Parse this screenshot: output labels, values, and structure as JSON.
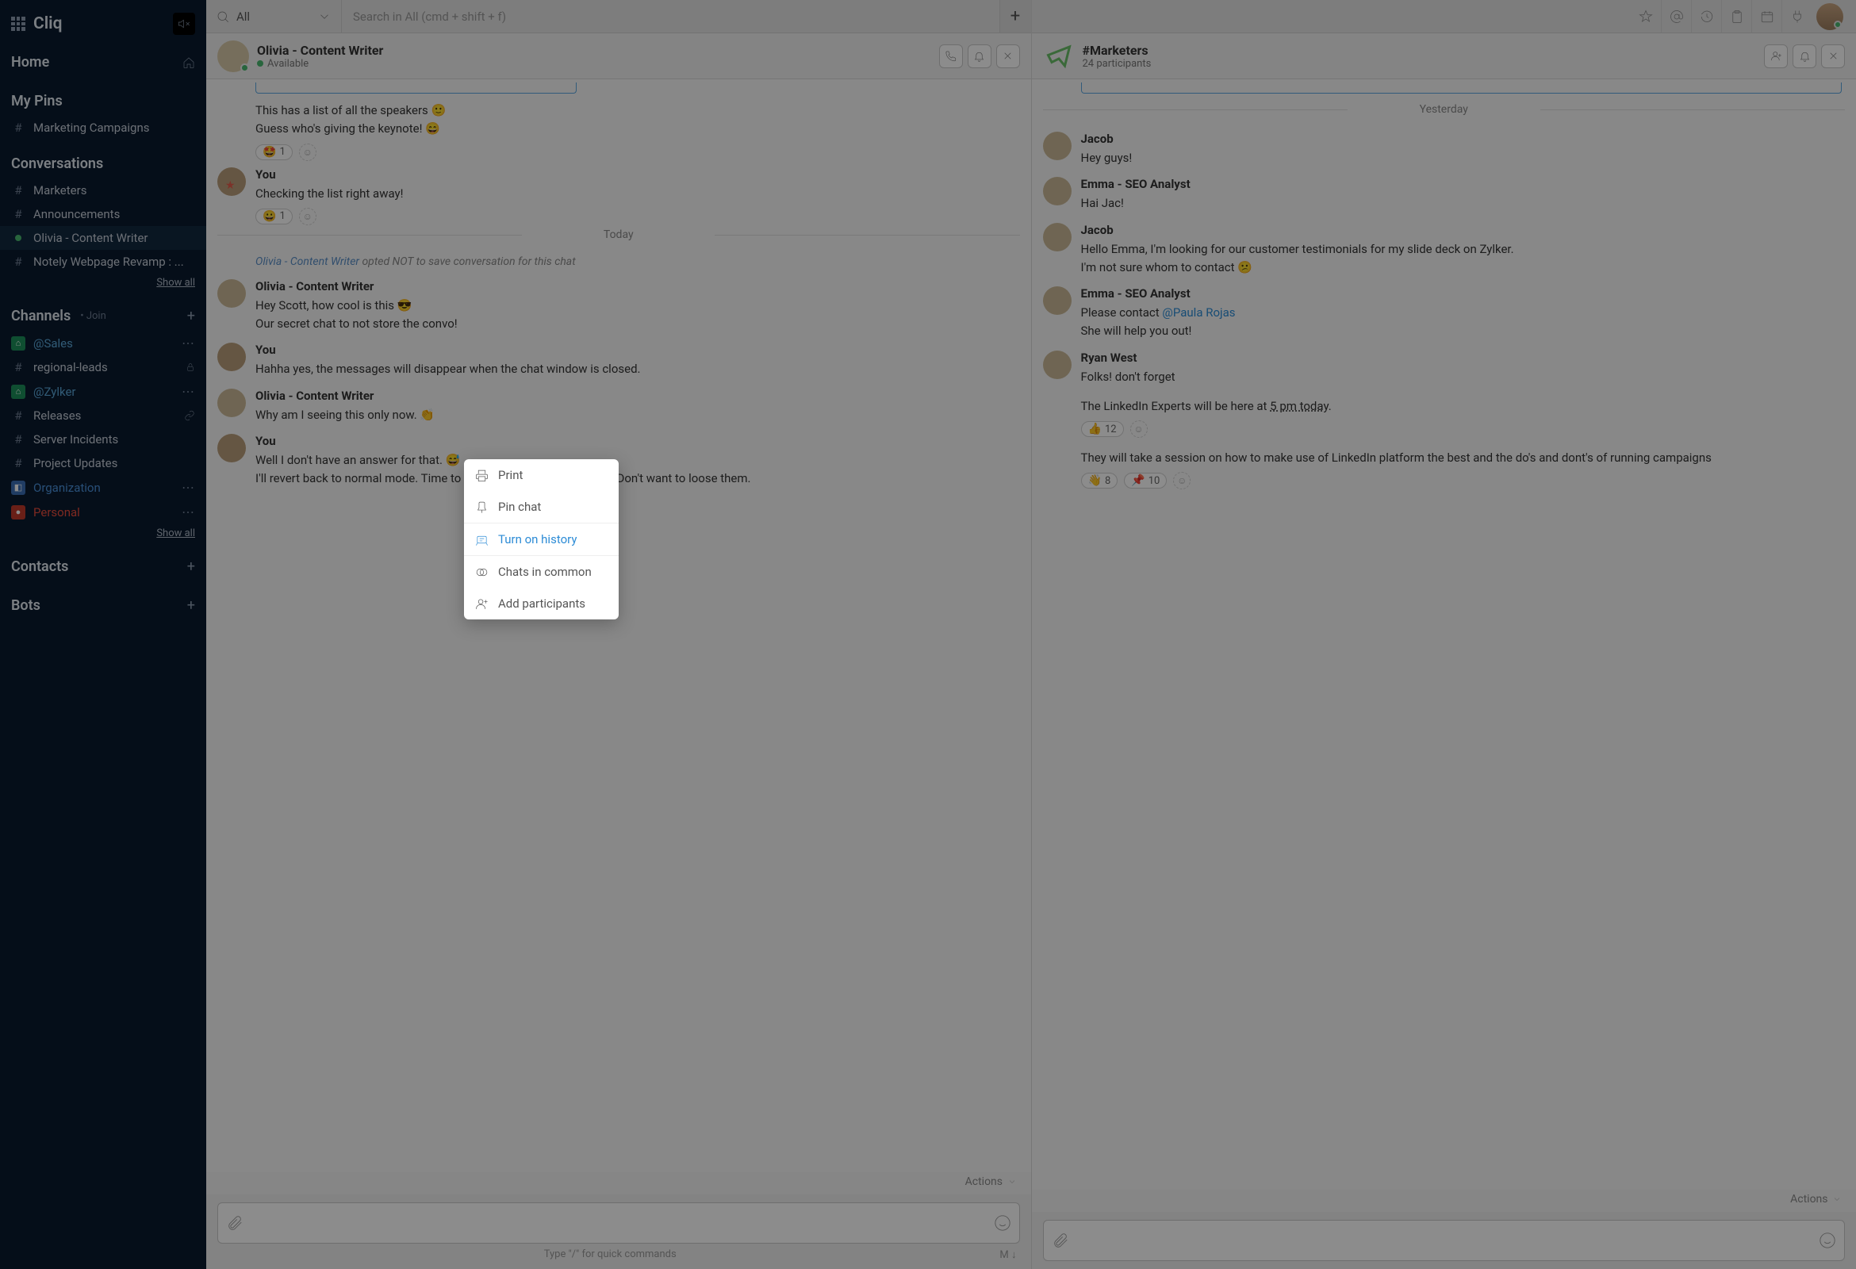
{
  "app": {
    "name": "Cliq"
  },
  "sidebar": {
    "home": "Home",
    "pins_head": "My Pins",
    "pins": [
      {
        "label": "Marketing Campaigns",
        "prefix": "#"
      }
    ],
    "convo_head": "Conversations",
    "convos": [
      {
        "label": "Marketers",
        "prefix": "#"
      },
      {
        "label": "Announcements",
        "prefix": "#"
      },
      {
        "label": "Olivia - Content Writer",
        "prefix": "dot",
        "active": true
      },
      {
        "label": "Notely Webpage Revamp : ...",
        "prefix": "#"
      }
    ],
    "show_all": "Show all",
    "channels_head": "Channels",
    "channels_join": "Join",
    "channels": [
      {
        "label": "@Sales",
        "badge": "green",
        "cls": "sales",
        "dots": true
      },
      {
        "label": "regional-leads",
        "prefix": "#",
        "lock": true
      },
      {
        "label": "@Zylker",
        "badge": "green",
        "cls": "sales",
        "dots": true
      },
      {
        "label": "Releases",
        "prefix": "#",
        "link": true
      },
      {
        "label": "Server Incidents",
        "prefix": "#"
      },
      {
        "label": "Project Updates",
        "prefix": "#"
      },
      {
        "label": "Organization",
        "badge": "blue",
        "cls": "org",
        "dots": true
      },
      {
        "label": "Personal",
        "badge": "red",
        "cls": "pers",
        "dots": true
      }
    ],
    "contacts_head": "Contacts",
    "bots_head": "Bots"
  },
  "topbar": {
    "scope": "All",
    "search_placeholder": "Search in All (cmd + shift + f)"
  },
  "left_panel": {
    "header": {
      "name": "Olivia - Content Writer",
      "status": "Available"
    },
    "notice_name": "Olivia - Content Writer",
    "notice_rest": " opted NOT to save conversation for this chat",
    "divider_today": "Today",
    "messages": [
      {
        "type": "cont_top",
        "lines": [
          "This has a list of all the speakers  🙂",
          "Guess who's giving the keynote!  😄"
        ],
        "react": {
          "emo": "🤩",
          "count": "1"
        }
      },
      {
        "type": "msg",
        "author": "You",
        "you": true,
        "star": true,
        "lines": [
          "Checking  the list right away!"
        ],
        "react": {
          "emo": "😀",
          "count": "1"
        }
      },
      {
        "type": "divider",
        "label": "Today"
      },
      {
        "type": "notice"
      },
      {
        "type": "msg",
        "author": "Olivia - Content Writer",
        "lines": [
          "Hey Scott, how cool is this  😎",
          "Our secret chat to not store the convo!"
        ]
      },
      {
        "type": "msg",
        "author": "You",
        "you": true,
        "lines": [
          "Hahha yes, the messages will disappear when the chat window is closed."
        ]
      },
      {
        "type": "msg",
        "author": "Olivia - Content Writer",
        "lines": [
          "Why am I seeing this only now.  👏"
        ]
      },
      {
        "type": "msg",
        "author": "You",
        "you": true,
        "lines": [
          "Well I don't have an answer for that.  😅",
          "I'll revert back to normal mode. Time to document some points now. Don't want to loose them."
        ]
      }
    ],
    "actions_label": "Actions"
  },
  "right_panel": {
    "header": {
      "name": "#Marketers",
      "sub": "24 participants"
    },
    "divider_label": "Yesterday",
    "messages": [
      {
        "author": "Jacob",
        "lines": [
          "Hey guys!"
        ]
      },
      {
        "author": "Emma - SEO Analyst",
        "lines": [
          "Hai Jac!"
        ]
      },
      {
        "author": "Jacob",
        "lines": [
          "Hello Emma, I'm looking for our customer testimonials for my slide deck on Zylker.",
          " I'm not sure whom to contact  😕"
        ]
      },
      {
        "author": "Emma - SEO Analyst",
        "lines_html": [
          "Please contact <span class='mention'>@Paula Rojas</span>",
          " She will help you out!"
        ]
      },
      {
        "author": "Ryan West",
        "lines_html": [
          "Folks! don't forget",
          "",
          "The LinkedIn Experts will be here at <span class='time-ul'>5 pm today</span>."
        ],
        "react": {
          "emo": "👍",
          "count": "12"
        },
        "spacer_after": true
      },
      {
        "cont": true,
        "lines": [
          "They will take a session on how to make use of LinkedIn platform the best and the do's and dont's of running campaigns"
        ],
        "reacts": [
          {
            "emo": "👋",
            "count": "8"
          },
          {
            "emo": "📌",
            "count": "10"
          }
        ]
      }
    ],
    "actions_label": "Actions"
  },
  "composer": {
    "hint": "Type \"/\" for quick commands",
    "mode": "M ↓"
  },
  "popover": {
    "items": [
      {
        "label": "Print",
        "icon": "print"
      },
      {
        "label": "Pin chat",
        "icon": "pin"
      },
      {
        "label": "Turn on history",
        "icon": "history",
        "hl": true
      },
      {
        "label": "Chats in common",
        "icon": "common"
      },
      {
        "label": "Add participants",
        "icon": "addp"
      }
    ]
  }
}
